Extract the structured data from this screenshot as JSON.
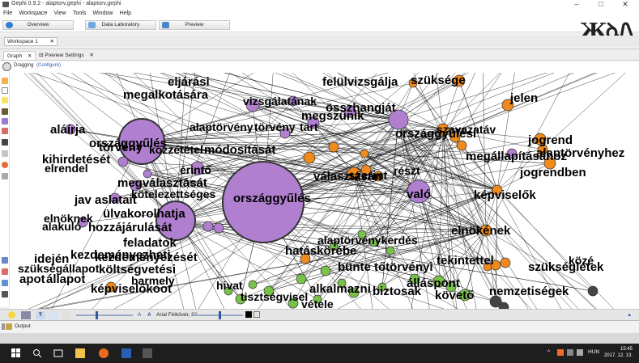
{
  "window": {
    "title": "Gephi 0.9.2 - alaptorv.gephi - alaptorv.gephi",
    "controls": [
      "–",
      "□",
      "✕"
    ]
  },
  "menu": [
    "File",
    "Workspace",
    "View",
    "Tools",
    "Window",
    "Help"
  ],
  "modes": [
    {
      "label": "Overview",
      "active": true
    },
    {
      "label": "Data Laboratory",
      "active": false
    },
    {
      "label": "Preview",
      "active": false
    }
  ],
  "workspace_tab": "Workspace 1",
  "panel_tabs": [
    "Graph",
    "Preview Settings"
  ],
  "drag": {
    "label": "Dragging",
    "configure": "(Configure)",
    "counter": "9"
  },
  "bottom": {
    "text_a_small": "A",
    "text_a_large": "A",
    "font": "Arial Félkövér, 32"
  },
  "output": {
    "label": "Output"
  },
  "tray": {
    "lang": "HUN",
    "time": "15:45",
    "date": "2017. 12. 13."
  },
  "colors": {
    "purple": "#b07fcf",
    "orange": "#f08a1c",
    "green": "#79c24a",
    "edge": "#111111"
  },
  "graph": {
    "labels": [
      "követelményei",
      "eljárási",
      "megalkotására",
      "felülvizsgálja",
      "szüksége",
      "jelen",
      "vizsgálatának",
      "összhangját",
      "megszűnik",
      "alaptörvény",
      "törvény",
      "tart",
      "szavazatáv",
      "országgyűlési",
      "jogrend",
      "alaptörvényhez",
      "megállapításához",
      "jogrendben",
      "aláírja",
      "országgyűlés",
      "törvény",
      "közzététel",
      "módosítását",
      "kihirdetését",
      "elrendel",
      "érintő",
      "választásán",
      "szerint",
      "részt",
      "megválasztását",
      "jav aslatait",
      "kötelezettséges",
      "országgyűlés",
      "való",
      "képviselők",
      "elnöknek",
      "alakuló",
      "ülvakorolhatja",
      "hozzájárulását",
      "feladatok",
      "kezdeményezheti",
      "elnökének",
      "alaptörvénykerdés",
      "hatáskörébe",
      "bünte tőtörvényi",
      "tekintettel",
      "szükségletek",
      "közé",
      "idején",
      "kezdeményezését",
      "szükségállapot",
      "költségvetési",
      "apot",
      "állapot",
      "barmely",
      "képviselőkoot",
      "hivat",
      "tisztségvisel",
      "alkalmazni",
      "biztosak",
      "álláspont",
      "követő",
      "nemzetiségek",
      "vétele"
    ]
  }
}
